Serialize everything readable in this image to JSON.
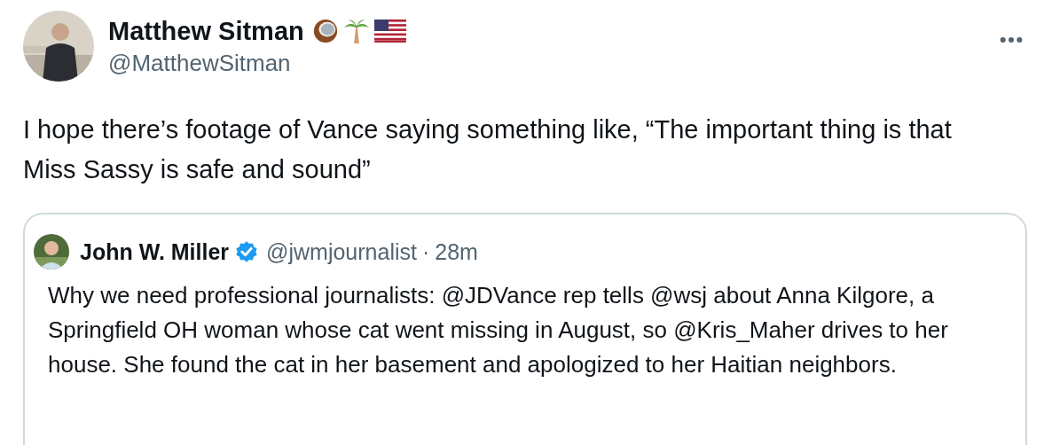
{
  "tweet": {
    "author": {
      "name": "Matthew Sitman",
      "handle": "@MatthewSitman"
    },
    "text": "I hope there’s footage of Vance saying something like, “The important thing is that Miss Sassy is safe and sound”",
    "quote": {
      "author": {
        "name": "John W. Miller",
        "verified": true,
        "handle": "@jwmjournalist",
        "separator": "·",
        "time": "28m"
      },
      "text": "Why we need professional journalists: @JDVance rep tells @wsj about Anna Kilgore, a Springfield OH woman whose cat went missing in August, so @Kris_Maher drives to her house. She found the cat in her basement and apologized to her Haitian neighbors."
    }
  }
}
